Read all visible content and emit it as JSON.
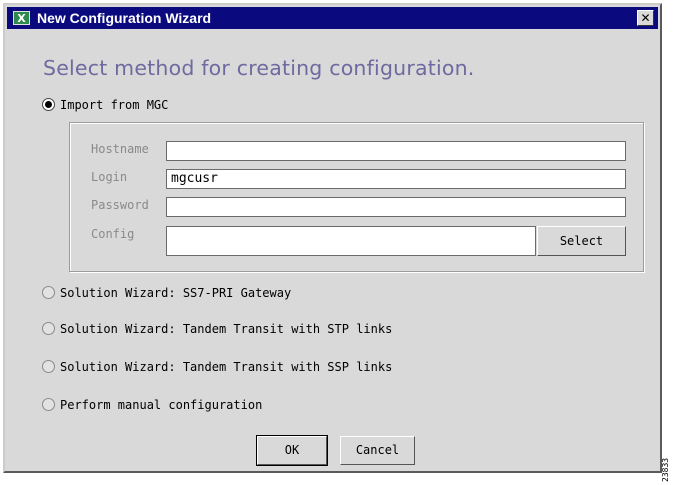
{
  "window": {
    "title": "New Configuration Wizard",
    "icon": "X",
    "close_glyph": "✕"
  },
  "heading": "Select method for creating configuration.",
  "options": [
    {
      "label": "Import from MGC",
      "selected": true
    },
    {
      "label": "Solution Wizard: SS7-PRI Gateway",
      "selected": false
    },
    {
      "label": "Solution Wizard: Tandem Transit with STP links",
      "selected": false
    },
    {
      "label": "Solution Wizard: Tandem Transit with SSP links",
      "selected": false
    },
    {
      "label": "Perform manual configuration",
      "selected": false
    }
  ],
  "import_form": {
    "hostname_label": "Hostname",
    "hostname_value": "",
    "login_label": "Login",
    "login_value": "mgcusr",
    "password_label": "Password",
    "password_value": "",
    "config_label": "Config",
    "config_value": "",
    "select_button": "Select"
  },
  "buttons": {
    "ok": "OK",
    "cancel": "Cancel"
  },
  "figure_id": "23833",
  "colors": {
    "titlebar": "#0a0a7e",
    "window_bg": "#d9d9d9",
    "heading": "#6e6aa0",
    "disabled_label": "#8a8a8a"
  }
}
